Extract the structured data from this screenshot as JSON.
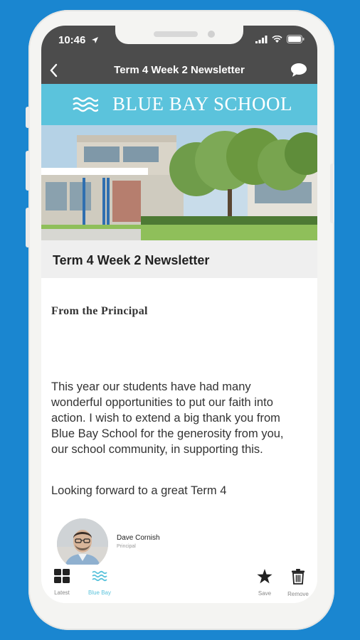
{
  "status": {
    "time": "10:46"
  },
  "nav": {
    "title": "Term 4 Week 2 Newsletter"
  },
  "banner": {
    "school_name": "BLUE BAY SCHOOL"
  },
  "article": {
    "title": "Term 4 Week 2 Newsletter",
    "heading": "From the Principal",
    "paragraph1": "This year our students have had many wonderful opportunities to put our faith into action. I wish to extend a big thank you from Blue Bay School for the generosity from you, our school community, in supporting this.",
    "paragraph2": "Looking forward to a great Term 4",
    "author_name": "Dave Cornish",
    "author_role": "Principal"
  },
  "tabs": [
    {
      "label": "Latest",
      "icon": "grid-icon"
    },
    {
      "label": "Blue Bay",
      "icon": "waves-icon",
      "active": true
    },
    {
      "label": "Save",
      "icon": "star-icon"
    },
    {
      "label": "Remove",
      "icon": "trash-icon"
    }
  ],
  "colors": {
    "background": "#1a86d0",
    "banner": "#5bc3dc",
    "navbar": "#4c4c4c"
  }
}
